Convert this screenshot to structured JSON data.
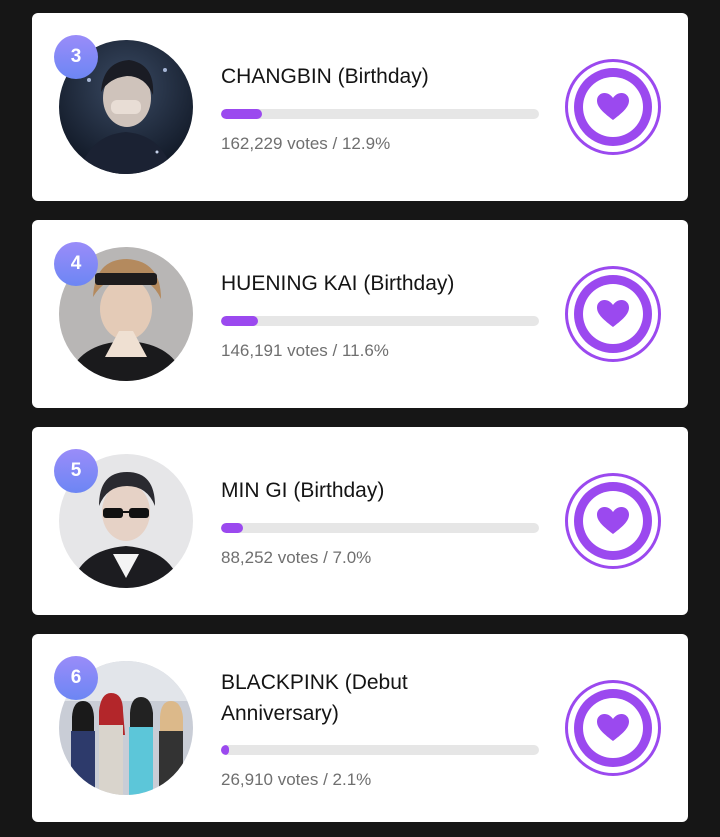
{
  "accent_color": "#9b49ef",
  "badge_gradient": [
    "#9a8cf9",
    "#6c86f4"
  ],
  "items": [
    {
      "rank": "3",
      "name": "CHANGBIN (Birthday)",
      "votes_text": "162,229 votes / 12.9%",
      "share": 0.129,
      "vote_icon": "heart-icon"
    },
    {
      "rank": "4",
      "name": "HUENING KAI (Birthday)",
      "votes_text": "146,191 votes / 11.6%",
      "share": 0.116,
      "vote_icon": "heart-icon"
    },
    {
      "rank": "5",
      "name": "MIN GI (Birthday)",
      "votes_text": "88,252 votes / 7.0%",
      "share": 0.07,
      "vote_icon": "heart-icon"
    },
    {
      "rank": "6",
      "name": "BLACKPINK (Debut Anniversary)",
      "votes_text": "26,910 votes / 2.1%",
      "share": 0.021,
      "vote_icon": "heart-icon"
    }
  ]
}
